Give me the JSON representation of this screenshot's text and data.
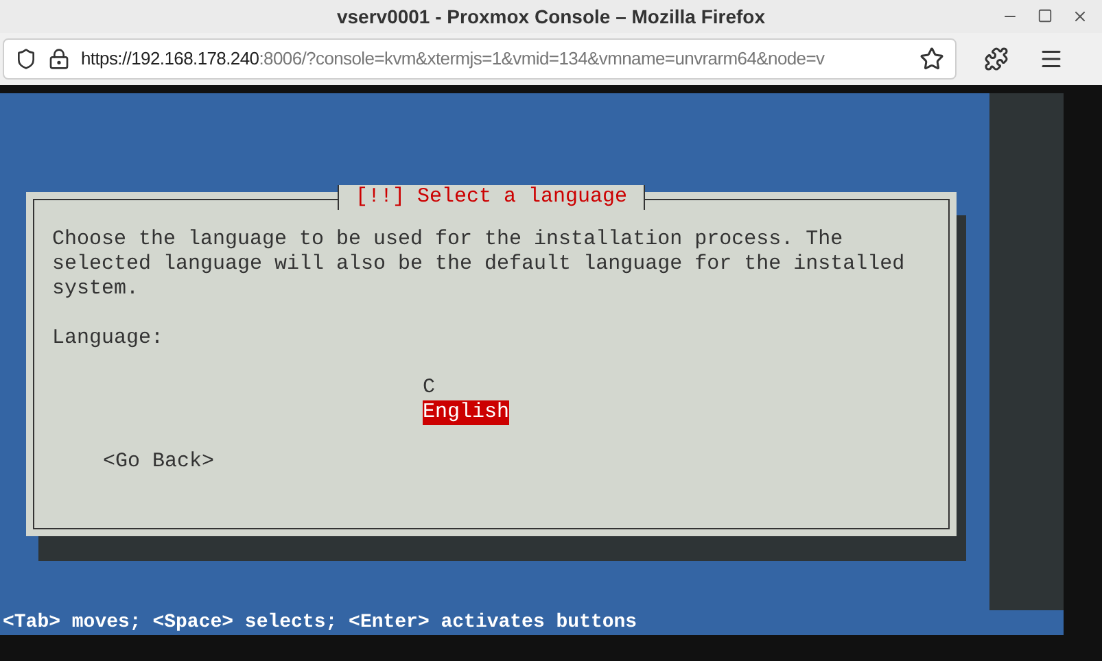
{
  "window": {
    "title": "vserv0001 - Proxmox Console – Mozilla Firefox"
  },
  "address_bar": {
    "url_host": "https://192.168.178.240",
    "url_rest": ":8006/?console=kvm&xtermjs=1&vmid=134&vmname=unvrarm64&node=v"
  },
  "dialog": {
    "title": "[!!] Select a language",
    "description": "Choose the language to be used for the installation process. The selected language will also be the default language for the installed system.",
    "label": "Language:",
    "options": [
      {
        "label": "C",
        "selected": false
      },
      {
        "label": "English",
        "selected": true
      }
    ],
    "back_button": "<Go Back>"
  },
  "status_bar": "<Tab> moves; <Space> selects; <Enter> activates buttons"
}
